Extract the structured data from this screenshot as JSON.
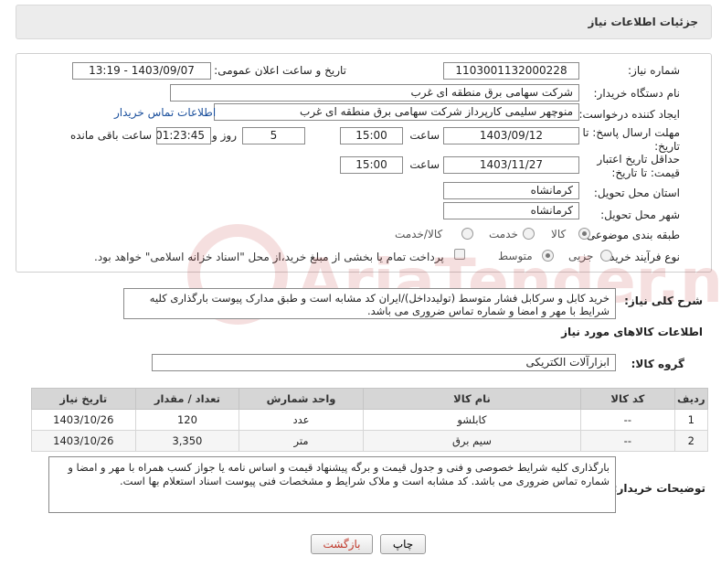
{
  "header": {
    "title": "جزئیات اطلاعات نیاز"
  },
  "info": {
    "need_number_label": "شماره نیاز:",
    "need_number": "1103001132000228",
    "announce_label": "تاریخ و ساعت اعلان عمومی:",
    "announce_value": "1403/09/07 - 13:19",
    "buyer_org_label": "نام دستگاه خریدار:",
    "buyer_org": "شرکت سهامی برق منطقه ای غرب",
    "creator_label": "ایجاد کننده درخواست:",
    "creator": "منوچهر  سلیمی کارپرداز شرکت سهامی برق منطقه ای غرب",
    "contact_link": "اطلاعات تماس خریدار",
    "deadline_label": "مهلت ارسال پاسخ: تا تاریخ:",
    "deadline_date": "1403/09/12",
    "time_label": "ساعت",
    "deadline_time": "15:00",
    "days_value": "5",
    "days_label": "روز و",
    "remaining_time": "01:23:45",
    "remaining_label": "ساعت باقی مانده",
    "price_validity_label": "حداقل تاریخ اعتبار قیمت: تا تاریخ:",
    "price_validity_date": "1403/11/27",
    "price_validity_time": "15:00",
    "province_label": "استان محل تحویل:",
    "province": "کرمانشاه",
    "city_label": "شهر محل تحویل:",
    "city": "کرمانشاه",
    "category_label": "طبقه بندی موضوعی:",
    "category_options": [
      "کالا",
      "خدمت",
      "کالا/خدمت"
    ],
    "process_label": "نوع فرآیند خرید :",
    "process_options": [
      "جزیی",
      "متوسط"
    ],
    "payment_note": "پرداخت تمام یا بخشی از مبلغ خرید،از محل \"اسناد خزانه اسلامی\" خواهد بود."
  },
  "description": {
    "label": "شرح کلی نیاز:",
    "text": "خرید کابل و سرکابل فشار متوسط (تولیدداخل)/ایران کد مشابه است و طبق مدارک پیوست بارگذاری کلیه شرایط با مهر و امضا و شماره تماس ضروری می باشد."
  },
  "goods": {
    "section_title": "اطلاعات کالاهای مورد نیاز",
    "group_label": "گروه کالا:",
    "group_value": "ابزارآلات الکتریکی",
    "columns": [
      "ردیف",
      "کد کالا",
      "نام کالا",
      "واحد شمارش",
      "تعداد / مقدار",
      "تاریخ نیاز"
    ],
    "rows": [
      [
        "1",
        "--",
        "کابلشو",
        "عدد",
        "120",
        "1403/10/26"
      ],
      [
        "2",
        "--",
        "سیم برق",
        "متر",
        "3,350",
        "1403/10/26"
      ]
    ]
  },
  "notes": {
    "label": "توضیحات خریدار:",
    "text": "بارگذاری کلیه شرایط خصوصی و فنی و جدول قیمت و برگه پیشنهاد قیمت و اساس نامه یا جواز کسب همراه با مهر و امضا و شماره تماس ضروری می باشد. کد مشابه است و ملاک شرایط و مشخصات فنی پیوست اسناد استعلام بها است."
  },
  "buttons": {
    "print": "چاپ",
    "back": "بازگشت"
  },
  "watermark": {
    "text": "AriaTender.neT"
  }
}
